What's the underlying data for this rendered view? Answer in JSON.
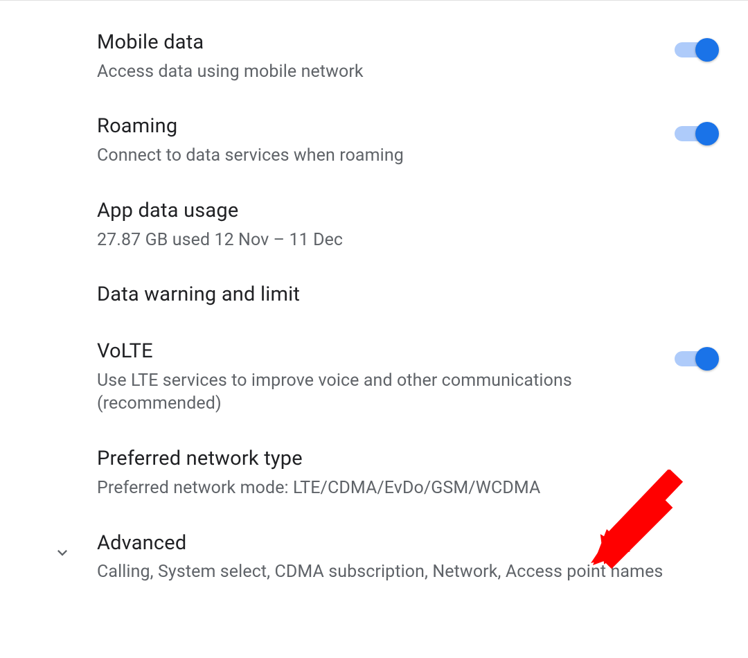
{
  "settings": {
    "items": [
      {
        "title": "Mobile data",
        "subtitle": "Access data using mobile network",
        "toggle": true,
        "toggled": true
      },
      {
        "title": "Roaming",
        "subtitle": "Connect to data services when roaming",
        "toggle": true,
        "toggled": true
      },
      {
        "title": "App data usage",
        "subtitle": "27.87 GB used 12 Nov – 11 Dec",
        "toggle": false
      },
      {
        "title": "Data warning and limit",
        "subtitle": "",
        "toggle": false
      },
      {
        "title": "VoLTE",
        "subtitle": "Use LTE services to improve voice and other communications (recommended)",
        "toggle": true,
        "toggled": true
      },
      {
        "title": "Preferred network type",
        "subtitle": "Preferred network mode: LTE/CDMA/EvDo/GSM/WCDMA",
        "toggle": false
      }
    ],
    "advanced": {
      "title": "Advanced",
      "subtitle": "Calling, System select, CDMA subscription, Network, Access point names"
    }
  },
  "colors": {
    "toggle_thumb": "#1a73e8",
    "toggle_track": "#aecbfa",
    "arrow": "#ff0000"
  }
}
